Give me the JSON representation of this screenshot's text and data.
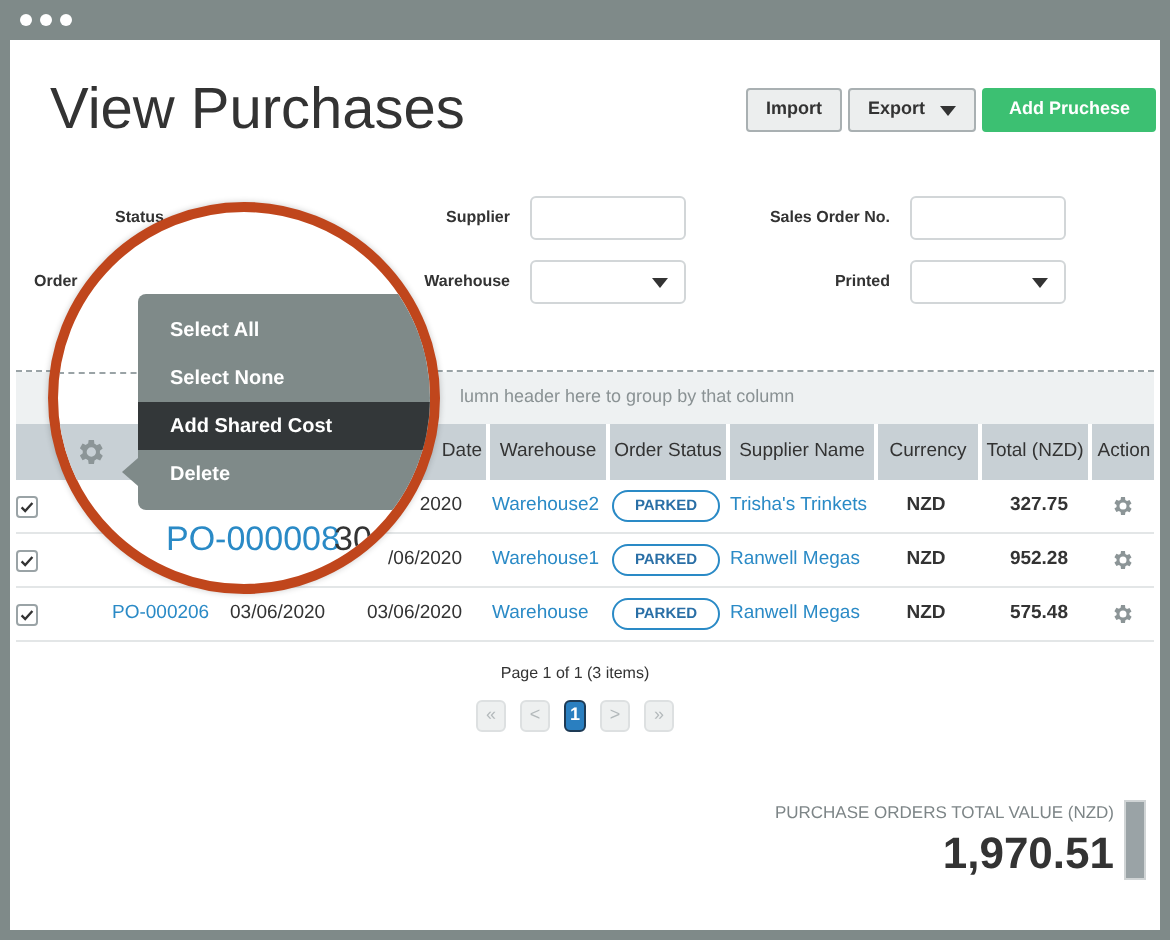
{
  "title": "View Purchases",
  "toolbar": [
    {
      "label": "Import",
      "kind": "plain"
    },
    {
      "label": "Export",
      "kind": "dropdown"
    },
    {
      "label": "Add Pruchese",
      "kind": "primary"
    }
  ],
  "filters": [
    {
      "label": "Status"
    },
    {
      "label": "Supplier",
      "kind": "text"
    },
    {
      "label": "Sales Order No.",
      "kind": "text"
    },
    {
      "label": "Order"
    },
    {
      "label": "Warehouse",
      "kind": "dropdown"
    },
    {
      "label": "Printed",
      "kind": "dropdown"
    }
  ],
  "group_hint": "lumn header here to group by that column",
  "table": {
    "columns": [
      "Date",
      "Warehouse",
      "Order Status",
      "Supplier Name",
      "Currency",
      "Total (NZD)",
      "Action"
    ],
    "rows": [
      {
        "checked": true,
        "required_date": "2020",
        "warehouse": "Warehouse2",
        "status": "PARKED",
        "supplier": "Trisha's Trinkets",
        "currency": "NZD",
        "total": "327.75"
      },
      {
        "checked": true,
        "required_date": "/06/2020",
        "warehouse": "Warehouse1",
        "status": "PARKED",
        "supplier": "Ranwell Megas",
        "currency": "NZD",
        "total": "952.28"
      },
      {
        "checked": true,
        "order_no": "PO-000206",
        "order_date": "03/06/2020",
        "required_date": "03/06/2020",
        "warehouse": "Warehouse",
        "status": "PARKED",
        "supplier": "Ranwell Megas",
        "currency": "NZD",
        "total": "575.48"
      }
    ]
  },
  "pagination": {
    "summary": "Page 1 of 1 (3 items)",
    "buttons": [
      {
        "label": "«",
        "selected": false
      },
      {
        "label": "<",
        "selected": false
      },
      {
        "label": "1",
        "selected": true
      },
      {
        "label": ">",
        "selected": false
      },
      {
        "label": "»",
        "selected": false
      }
    ]
  },
  "total": {
    "label": "PURCHASE ORDERS TOTAL VALUE (NZD)",
    "value": "1,970.51"
  },
  "magnifier": {
    "menu": [
      {
        "label": "Select All",
        "selected": false
      },
      {
        "label": "Select None",
        "selected": false
      },
      {
        "label": "Add Shared Cost",
        "selected": true
      },
      {
        "label": "Delete",
        "selected": false
      }
    ],
    "order_no": "PO-000008",
    "date": "30"
  }
}
